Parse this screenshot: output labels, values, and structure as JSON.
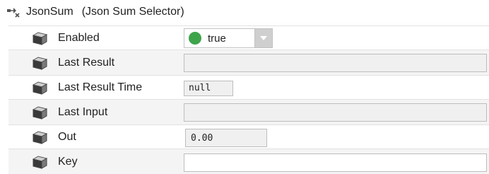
{
  "header": {
    "name": "JsonSum",
    "type": "(Json Sum Selector)",
    "icon": "component-link-icon"
  },
  "properties": [
    {
      "label": "Enabled",
      "kind": "dropdown",
      "value": "true",
      "status_color": "#3ea44c"
    },
    {
      "label": "Last Result",
      "kind": "readonly",
      "value": ""
    },
    {
      "label": "Last Result Time",
      "kind": "readonly-mono",
      "value": "null"
    },
    {
      "label": "Last Input",
      "kind": "readonly",
      "value": ""
    },
    {
      "label": "Out",
      "kind": "readonly-mono",
      "value": "0.00"
    },
    {
      "label": "Key",
      "kind": "input",
      "value": ""
    }
  ],
  "colors": {
    "enabled_dot": "#3ea44c",
    "field_bg": "#f0f0f0",
    "row_alt_bg": "#f4f4f4"
  }
}
